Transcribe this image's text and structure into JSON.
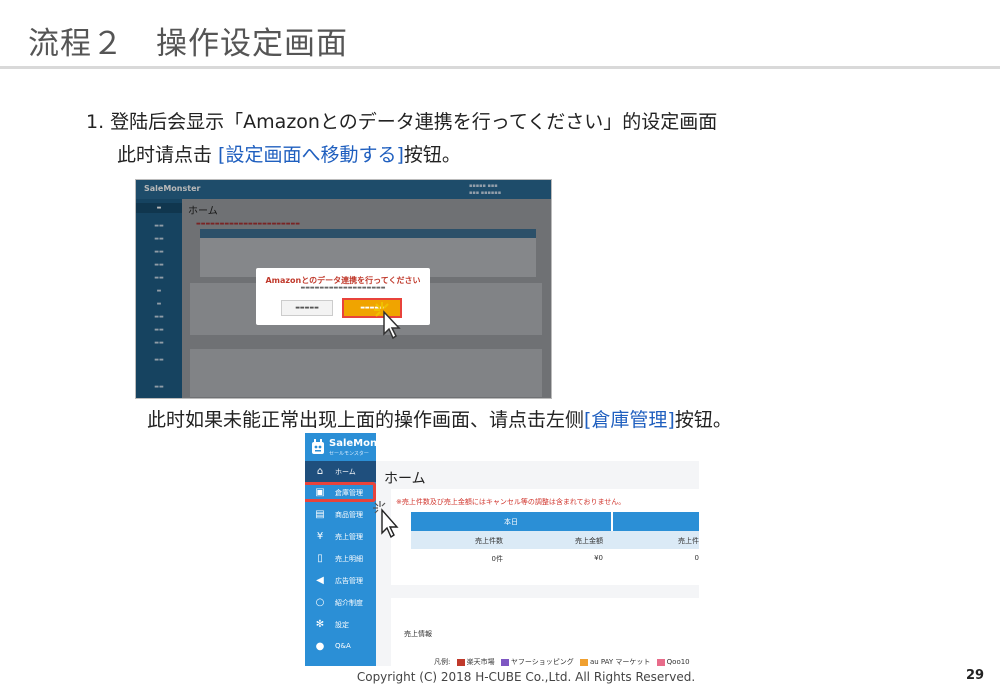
{
  "title": "流程２　操作设定画面",
  "instructions": {
    "line1": "1.  登陆后会显示「Amazonとのデータ連携を行ってください」的设定画面",
    "line2_pre": "此时请点击 ",
    "line2_link": "[設定画面へ移動する]",
    "line2_post": "按钮。",
    "line3_pre": "此时如果未能正常出现上面的操作画面、请点击左侧",
    "line3_link": "[倉庫管理]",
    "line3_post": "按钮。"
  },
  "screenshot1": {
    "brand": "SaleMonster",
    "heading": "ホーム",
    "modal_title": "Amazonとのデータ連携を行ってください",
    "highlight_color": "#e8433b"
  },
  "screenshot2": {
    "brand": "SaleMonster",
    "brand_sub": "セールモンスター",
    "heading": "ホーム",
    "nav": [
      {
        "icon": "home-icon",
        "label": "ホーム"
      },
      {
        "icon": "warehouse-icon",
        "label": "倉庫管理"
      },
      {
        "icon": "gift-icon",
        "label": "商品管理"
      },
      {
        "icon": "yen-icon",
        "label": "売上管理"
      },
      {
        "icon": "document-icon",
        "label": "売上明細"
      },
      {
        "icon": "megaphone-icon",
        "label": "広告管理"
      },
      {
        "icon": "chat-icon",
        "label": "紹介制度"
      },
      {
        "icon": "gear-icon",
        "label": "設定"
      },
      {
        "icon": "bubbles-icon",
        "label": "Q&A"
      }
    ],
    "warning": "※売上件数及び売上金額にはキャンセル等の調整は含まれておりません。",
    "table": {
      "header_today": "本日",
      "col_count": "売上件数",
      "col_amount": "売上金額",
      "col_partial": "売上件",
      "val_count": "0件",
      "val_amount": "¥0",
      "val_partial": "0"
    },
    "sales_info": "売上情報",
    "legend": {
      "prefix": "凡例:",
      "items": [
        {
          "label": "楽天市場",
          "color": "#c0392b"
        },
        {
          "label": "ヤフーショッピング",
          "color": "#7e57c2"
        },
        {
          "label": "au PAY マーケット",
          "color": "#f0a030"
        },
        {
          "label": "Qoo10",
          "color": "#e86c8a"
        }
      ]
    },
    "accent_color": "#2b8fd6",
    "highlight_color": "#e8433b"
  },
  "footer": {
    "copyright": "Copyright (C) 2018 H-CUBE Co.,Ltd. All Rights Reserved.",
    "page_number": "29"
  }
}
